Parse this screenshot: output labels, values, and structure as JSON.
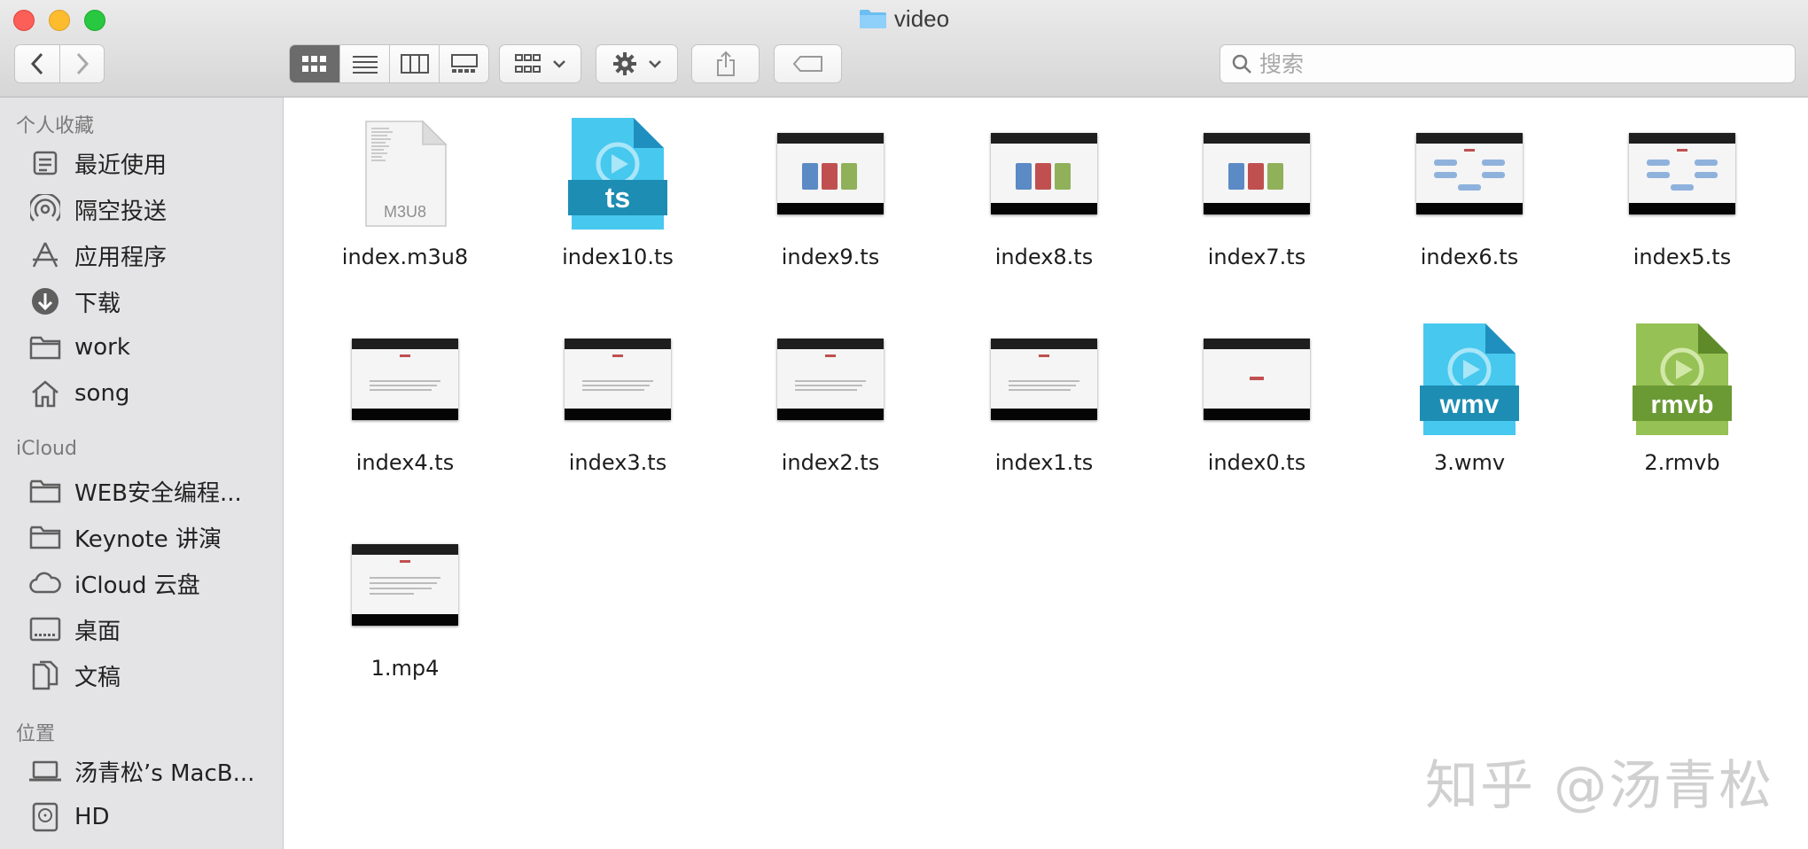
{
  "window": {
    "title": "video"
  },
  "colors": {
    "accent": "#4a90d9",
    "sidebar_bg": "#e4e4e6",
    "ts_icon": "#3cb9e0",
    "rmvb_icon": "#8bb84a"
  },
  "search": {
    "placeholder": "搜索"
  },
  "sidebar": {
    "sections": [
      {
        "title": "个人收藏",
        "items": [
          {
            "label": "最近使用",
            "icon": "recents-icon"
          },
          {
            "label": "隔空投送",
            "icon": "airdrop-icon"
          },
          {
            "label": "应用程序",
            "icon": "applications-icon"
          },
          {
            "label": "下载",
            "icon": "downloads-icon"
          },
          {
            "label": "work",
            "icon": "folder-icon"
          },
          {
            "label": "song",
            "icon": "home-icon"
          }
        ]
      },
      {
        "title": "iCloud",
        "items": [
          {
            "label": "WEB安全编程...",
            "icon": "folder-icon"
          },
          {
            "label": "Keynote 讲演",
            "icon": "folder-icon"
          },
          {
            "label": "iCloud 云盘",
            "icon": "cloud-icon"
          },
          {
            "label": "桌面",
            "icon": "desktop-icon"
          },
          {
            "label": "文稿",
            "icon": "documents-icon"
          }
        ]
      },
      {
        "title": "位置",
        "items": [
          {
            "label": "汤青松’s MacB...",
            "icon": "laptop-icon"
          },
          {
            "label": "HD",
            "icon": "disk-icon"
          }
        ]
      }
    ]
  },
  "files": [
    {
      "name": "index.m3u8",
      "kind": "doc",
      "badge": "M3U8"
    },
    {
      "name": "index10.ts",
      "kind": "media",
      "badge": "ts"
    },
    {
      "name": "index9.ts",
      "kind": "video"
    },
    {
      "name": "index8.ts",
      "kind": "video"
    },
    {
      "name": "index7.ts",
      "kind": "video"
    },
    {
      "name": "index6.ts",
      "kind": "video"
    },
    {
      "name": "index5.ts",
      "kind": "video"
    },
    {
      "name": "index4.ts",
      "kind": "video"
    },
    {
      "name": "index3.ts",
      "kind": "video"
    },
    {
      "name": "index2.ts",
      "kind": "video"
    },
    {
      "name": "index1.ts",
      "kind": "video"
    },
    {
      "name": "index0.ts",
      "kind": "video"
    },
    {
      "name": "3.wmv",
      "kind": "media",
      "badge": "wmv"
    },
    {
      "name": "2.rmvb",
      "kind": "media",
      "badge": "rmvb"
    },
    {
      "name": "1.mp4",
      "kind": "video"
    }
  ],
  "watermark": "知乎 @汤青松"
}
